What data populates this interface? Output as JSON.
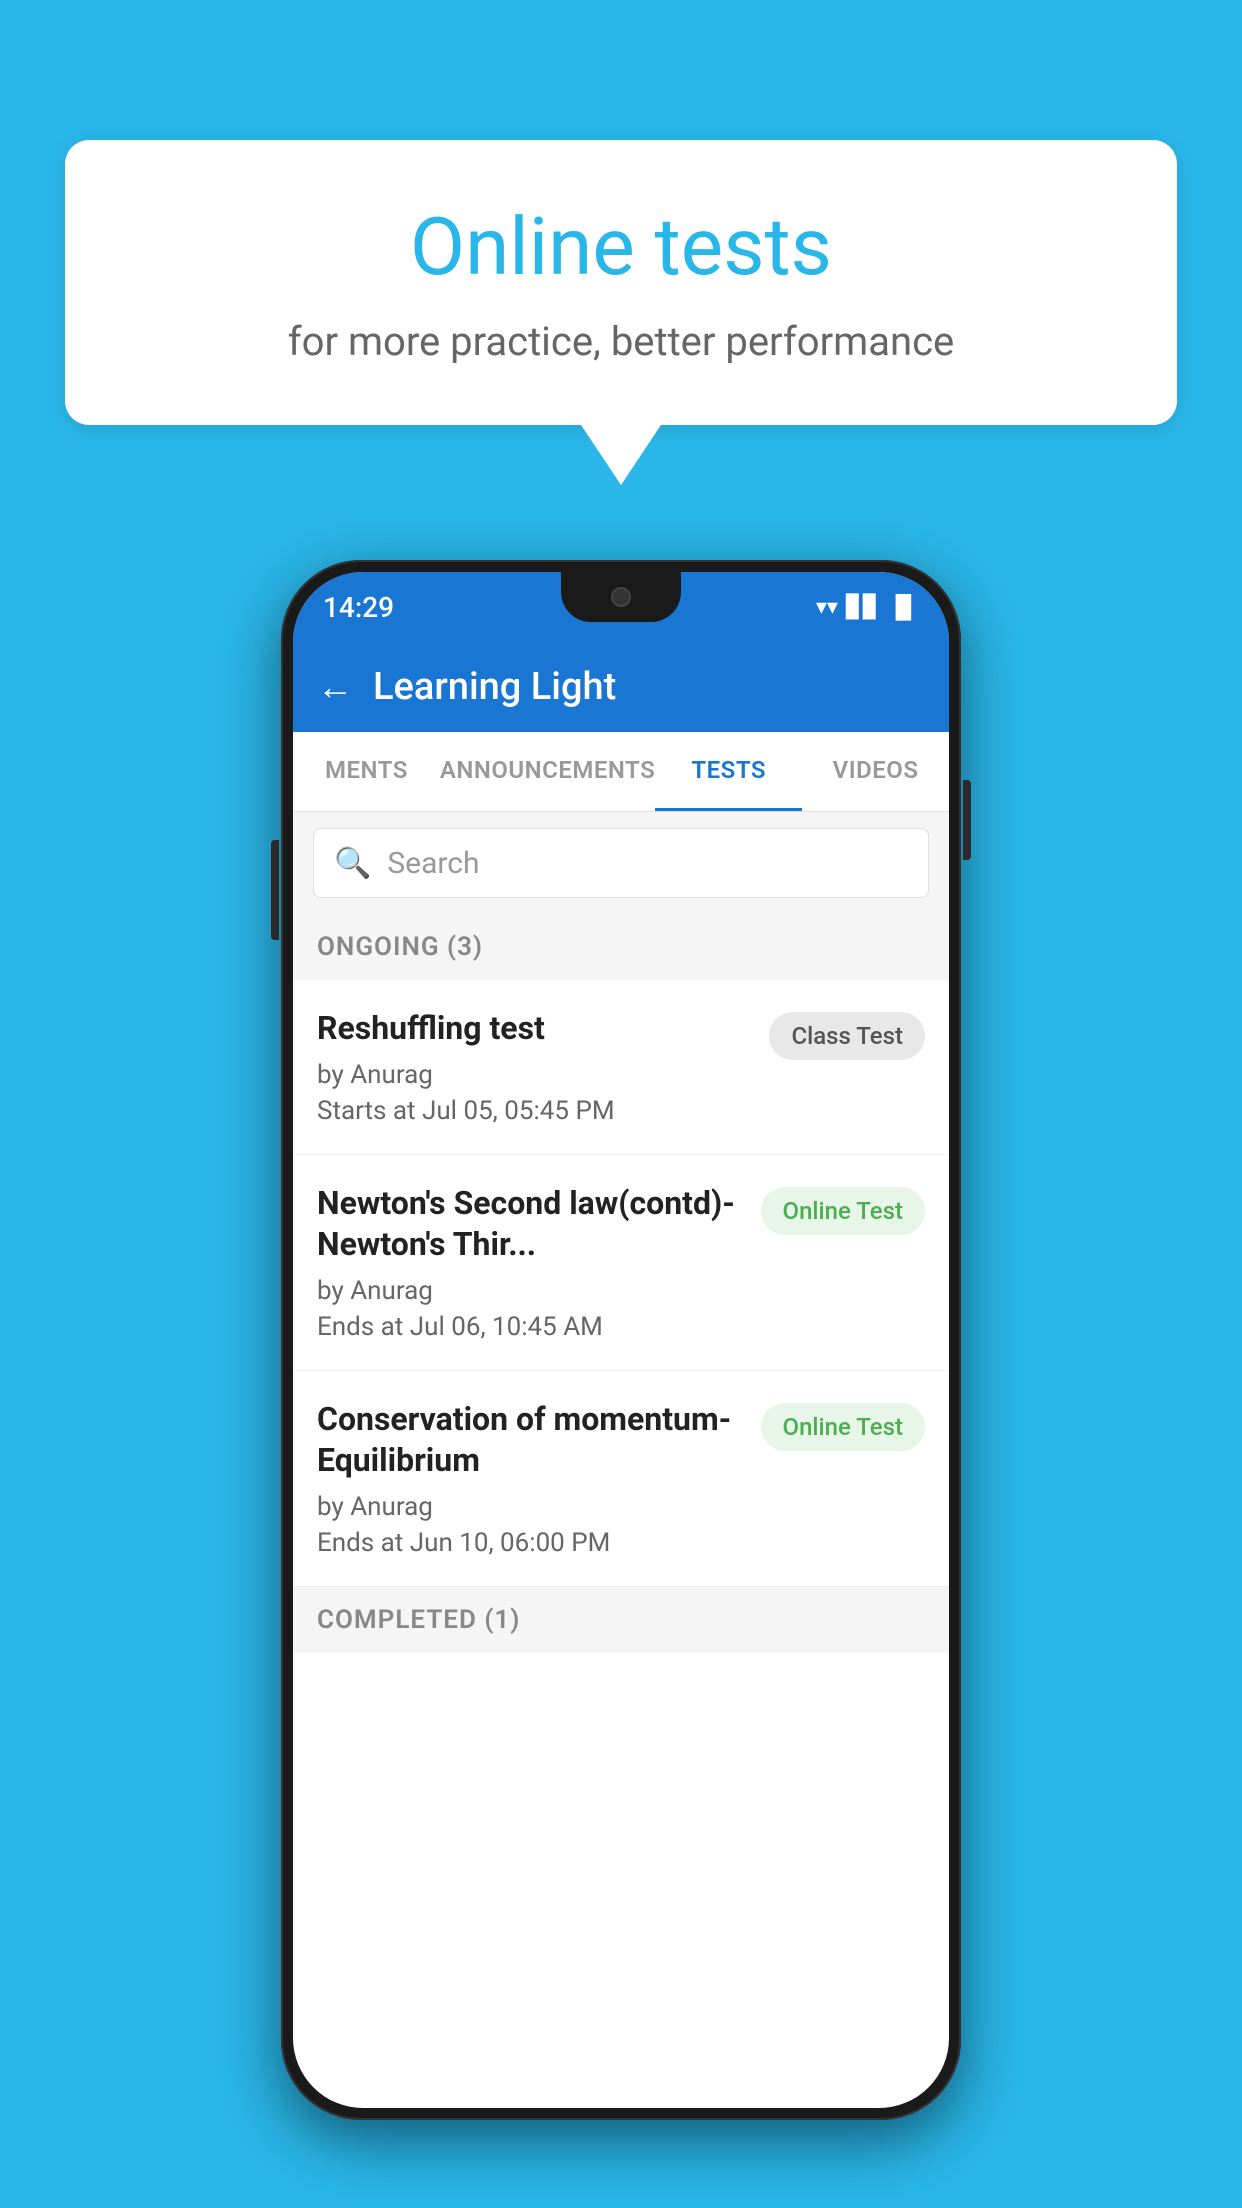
{
  "background": {
    "color": "#29B6E8"
  },
  "speechBubble": {
    "title": "Online tests",
    "subtitle": "for more practice, better performance"
  },
  "phone": {
    "statusBar": {
      "time": "14:29",
      "wifiIcon": "▲",
      "signalIcon": "▲",
      "batteryIcon": "▐"
    },
    "appBar": {
      "title": "Learning Light",
      "backArrow": "←"
    },
    "tabs": [
      {
        "label": "MENTS",
        "active": false
      },
      {
        "label": "ANNOUNCEMENTS",
        "active": false
      },
      {
        "label": "TESTS",
        "active": true
      },
      {
        "label": "VIDEOS",
        "active": false
      }
    ],
    "searchBar": {
      "placeholder": "Search",
      "icon": "🔍"
    },
    "ongoingSection": {
      "label": "ONGOING (3)"
    },
    "tests": [
      {
        "title": "Reshuffling test",
        "author": "by Anurag",
        "date": "Starts at  Jul 05, 05:45 PM",
        "badge": "Class Test",
        "badgeType": "class"
      },
      {
        "title": "Newton's Second law(contd)-Newton's Thir...",
        "author": "by Anurag",
        "date": "Ends at  Jul 06, 10:45 AM",
        "badge": "Online Test",
        "badgeType": "online"
      },
      {
        "title": "Conservation of momentum-Equilibrium",
        "author": "by Anurag",
        "date": "Ends at  Jun 10, 06:00 PM",
        "badge": "Online Test",
        "badgeType": "online"
      }
    ],
    "completedSection": {
      "label": "COMPLETED (1)"
    }
  }
}
